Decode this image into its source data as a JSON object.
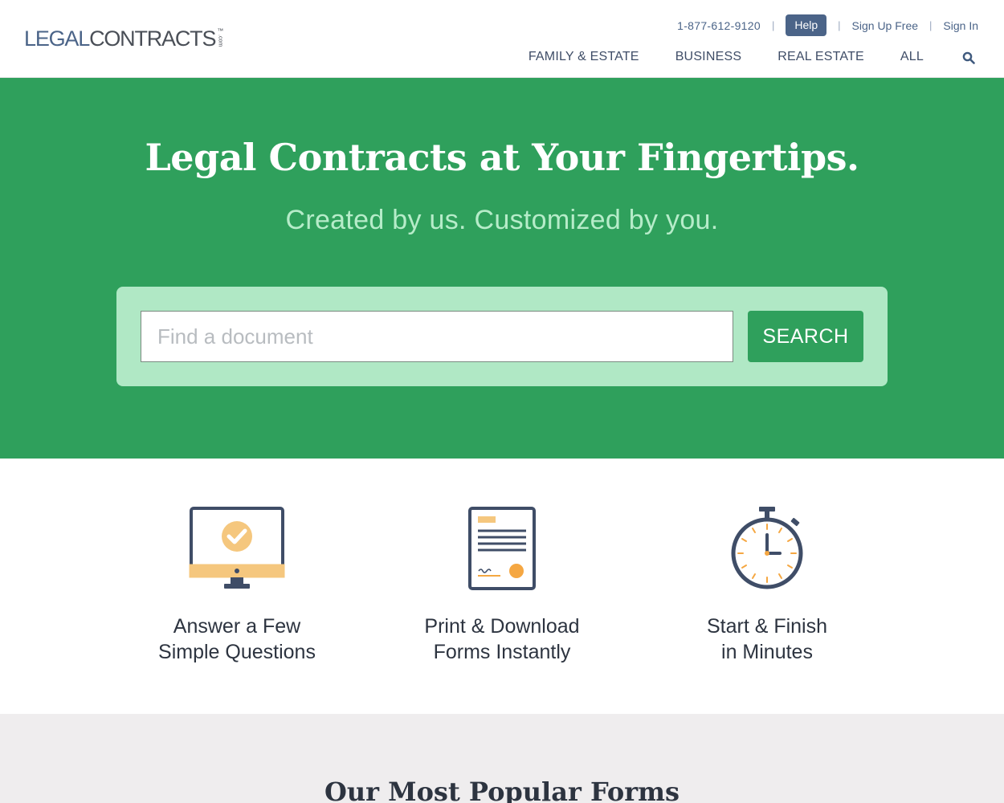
{
  "header": {
    "logo": {
      "legal": "LEGAL",
      "contracts": "CONTRACTS",
      "tm": "™",
      "com": ".com"
    },
    "phone": "1-877-612-9120",
    "help_label": "Help",
    "signup_label": "Sign Up Free",
    "signin_label": "Sign In",
    "separator": "|",
    "nav": [
      {
        "label": "FAMILY & ESTATE"
      },
      {
        "label": "BUSINESS"
      },
      {
        "label": "REAL ESTATE"
      },
      {
        "label": "ALL"
      }
    ],
    "nav_search_icon": "search-icon"
  },
  "hero": {
    "title": "Legal Contracts at Your Fingertips.",
    "subtitle": "Created by us. Customized by you.",
    "search": {
      "placeholder": "Find a document",
      "value": "",
      "button_label": "SEARCH"
    }
  },
  "features": [
    {
      "icon": "computer-check-icon",
      "line1": "Answer a Few",
      "line2": "Simple Questions"
    },
    {
      "icon": "document-icon",
      "line1": "Print & Download",
      "line2": "Forms Instantly"
    },
    {
      "icon": "stopwatch-icon",
      "line1": "Start & Finish",
      "line2": "in Minutes"
    }
  ],
  "popular": {
    "title": "Our Most Popular Forms"
  },
  "colors": {
    "brand_green": "#2fa05c",
    "search_panel": "#b0e8c5",
    "navy": "#4b6488",
    "accent_orange": "#f5a742",
    "popular_bg": "#efedee"
  }
}
